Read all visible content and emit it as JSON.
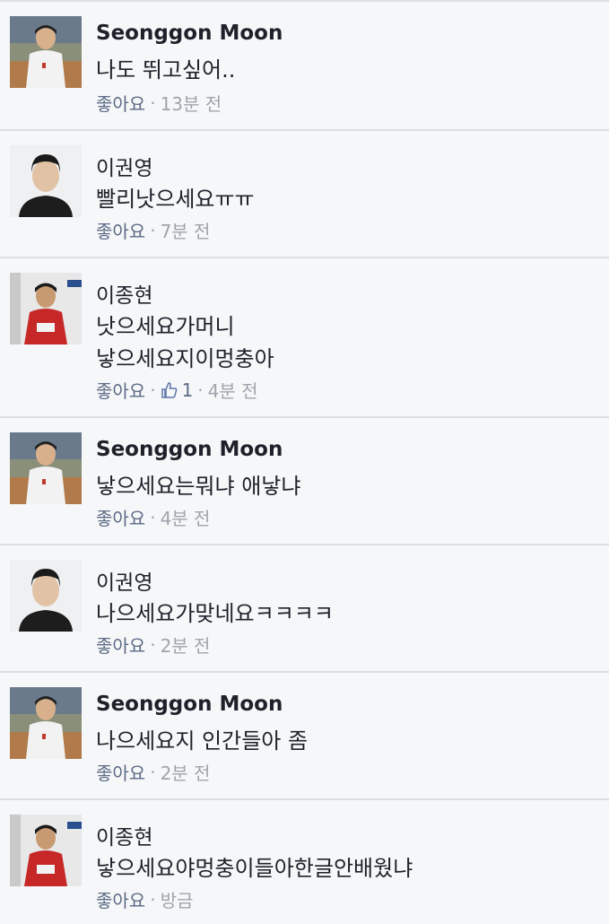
{
  "comments": [
    {
      "author": "Seonggon Moon",
      "lines": [
        "나도 뛰고싶어.."
      ],
      "like_label": "좋아요",
      "likes": "",
      "time": "13분 전",
      "avatar": "photo-court"
    },
    {
      "author": "이권영",
      "lines": [
        "빨리낫으세요ㅠㅠ"
      ],
      "like_label": "좋아요",
      "likes": "",
      "time": "7분 전",
      "avatar": "photo-portrait"
    },
    {
      "author": "이종현",
      "lines": [
        "낫으세요가머니",
        "낳으세요지이멍충아"
      ],
      "like_label": "좋아요",
      "likes": "1",
      "time": "4분 전",
      "avatar": "photo-jersey"
    },
    {
      "author": "Seonggon Moon",
      "lines": [
        "낳으세요는뭐냐 애낳냐"
      ],
      "like_label": "좋아요",
      "likes": "",
      "time": "4분 전",
      "avatar": "photo-court"
    },
    {
      "author": "이권영",
      "lines": [
        "나으세요가맞네요ㅋㅋㅋㅋ"
      ],
      "like_label": "좋아요",
      "likes": "",
      "time": "2분 전",
      "avatar": "photo-portrait"
    },
    {
      "author": "Seonggon Moon",
      "lines": [
        "나으세요지 인간들아 좀"
      ],
      "like_label": "좋아요",
      "likes": "",
      "time": "2분 전",
      "avatar": "photo-court"
    },
    {
      "author": "이종현",
      "lines": [
        "낳으세요야멍충이들아한글안배웠냐"
      ],
      "like_label": "좋아요",
      "likes": "",
      "time": "방금",
      "avatar": "photo-jersey"
    }
  ],
  "colors": {
    "author": "#1d2129",
    "meta": "#90949c",
    "link": "#5d6b86",
    "divider": "#dcdee3",
    "background": "#f6f7f9"
  }
}
